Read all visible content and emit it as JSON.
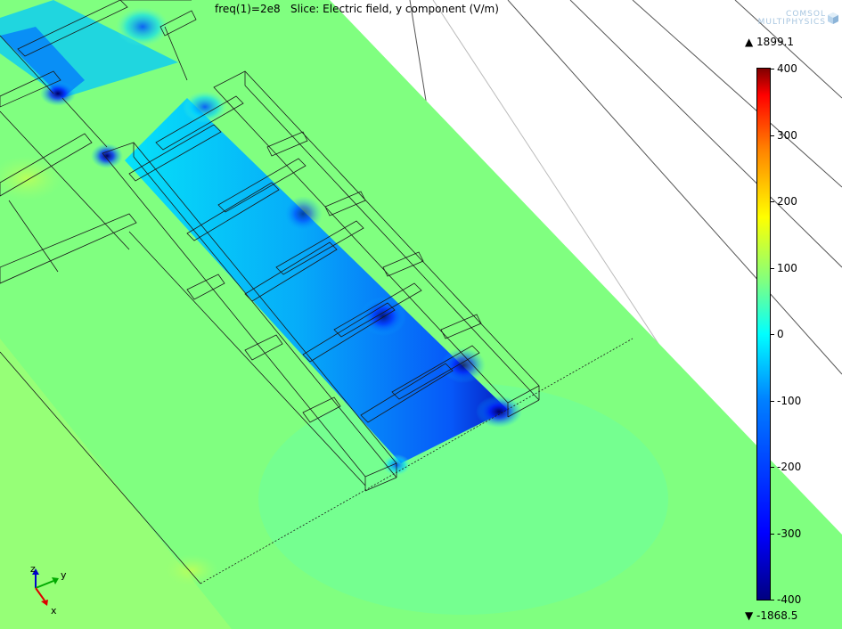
{
  "title": "freq(1)=2e8   Slice: Electric field, y component (V/m)",
  "logo": {
    "line1": "COMSOL",
    "line2": "MULTIPHYSICS",
    "icon": "comsol-cube-icon"
  },
  "colorbar": {
    "max_marker": "▲ 1899.1",
    "min_marker": "▼ -1868.5",
    "ticks": [
      "400",
      "300",
      "200",
      "100",
      "0",
      "-100",
      "-200",
      "-300",
      "-400"
    ]
  },
  "axes": {
    "x": "x",
    "y": "y",
    "z": "z"
  },
  "colors": {
    "field_background": "#80ff80",
    "stroke": "#000000"
  }
}
